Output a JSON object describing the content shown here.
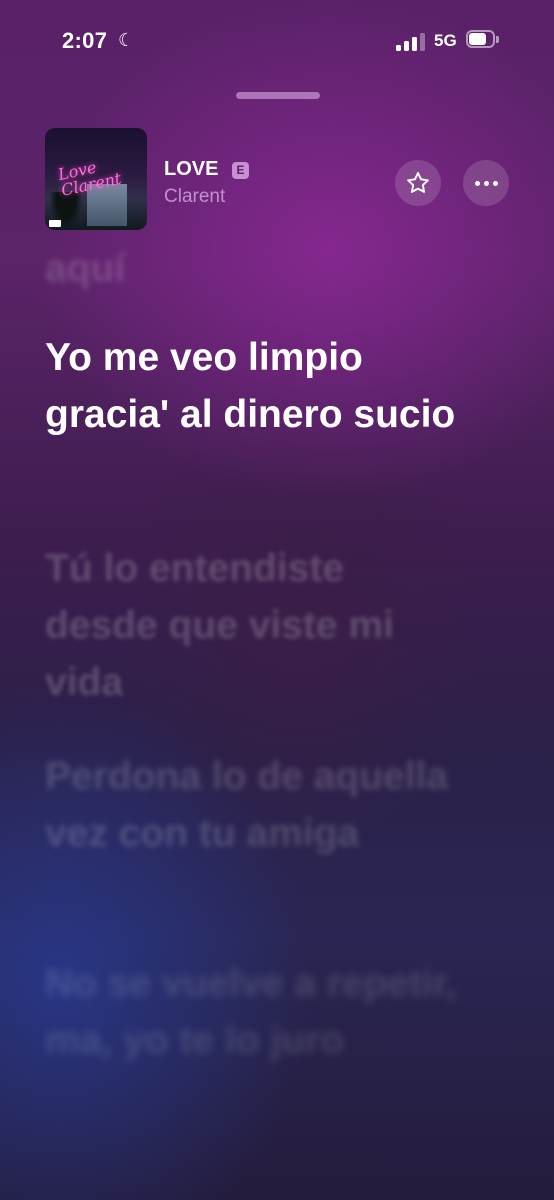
{
  "status_bar": {
    "time": "2:07",
    "network": "5G",
    "battery_percent": 75,
    "signal_bars": 3
  },
  "track": {
    "title": "LOVE",
    "explicit_badge": "E",
    "artist": "Clarent"
  },
  "artwork": {
    "text": "Love Clarent"
  },
  "icons": {
    "star": "star-icon",
    "more": "more-icon",
    "moon": "moon-icon"
  },
  "lyrics": {
    "previous": "aquí",
    "current": "Yo me veo limpio gracia' al dinero sucio",
    "next": [
      "Tú lo entendiste desde que viste mi vida",
      "Perdona lo de aquella vez con tu amiga",
      "No se vuelve a repetir, ma, yo te lo juro"
    ]
  }
}
